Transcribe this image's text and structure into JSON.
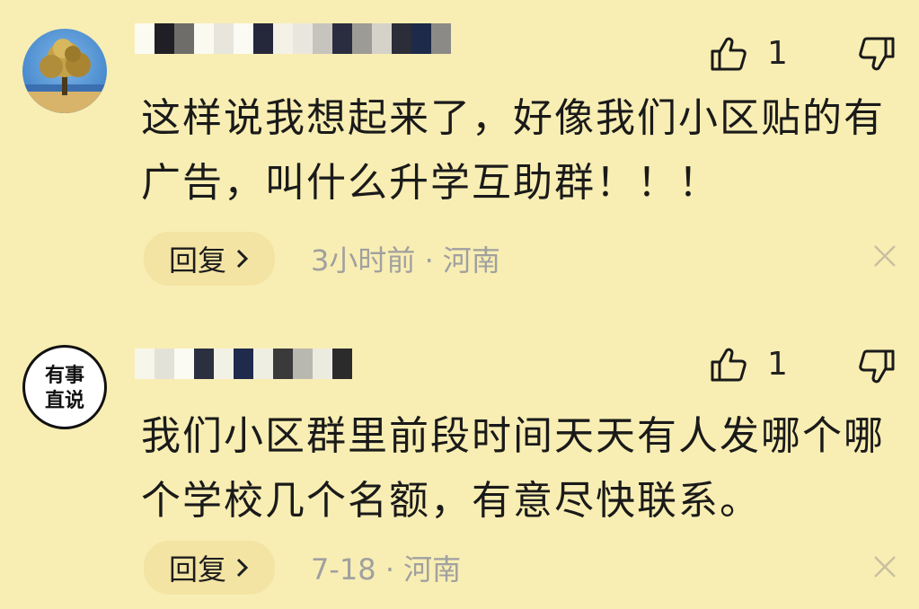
{
  "comments": [
    {
      "content": "这样说我想起来了，好像我们小区贴的有广告，叫什么升学互助群！！！",
      "like_count": "1",
      "reply_label": "回复",
      "time": "3小时前",
      "separator": "·",
      "location": "河南",
      "icons": {
        "like": "thumb-up-icon",
        "dislike": "thumb-down-icon",
        "reply_arrow": "chevron-right-icon",
        "close": "close-icon"
      }
    },
    {
      "avatar_logo_text": [
        "有事",
        "直说"
      ],
      "content": "我们小区群里前段时间天天有人发哪个哪个学校几个名额，有意尽快联系。",
      "like_count": "1",
      "reply_label": "回复",
      "time": "7-18",
      "separator": "·",
      "location": "河南",
      "icons": {
        "like": "thumb-up-icon",
        "dislike": "thumb-down-icon",
        "reply_arrow": "chevron-right-icon",
        "close": "close-icon"
      }
    }
  ],
  "colors": {
    "background": "#f8eeb3",
    "text": "#1a1a1a",
    "meta": "#a0a0a0",
    "reply_bg": "#f3e4a4"
  }
}
